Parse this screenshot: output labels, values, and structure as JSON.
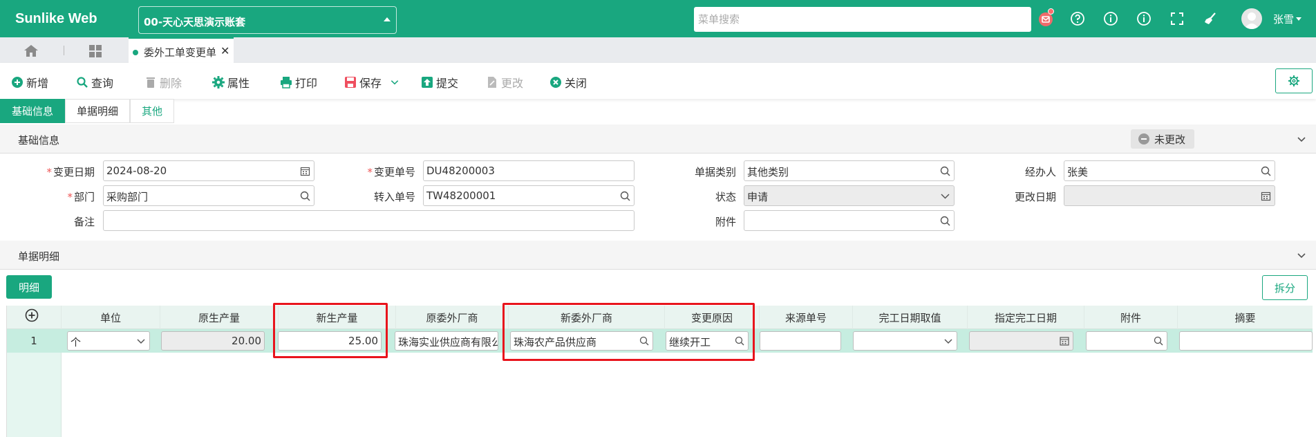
{
  "app": {
    "title": "Sunlike Web",
    "account": "00-天心天思演示账套"
  },
  "header": {
    "search_placeholder": "菜单搜索",
    "user": "张雪"
  },
  "tabs": {
    "document_tab": "委外工单变更单"
  },
  "toolbar": {
    "add": "新增",
    "query": "查询",
    "delete": "删除",
    "properties": "属性",
    "print": "打印",
    "save": "保存",
    "submit": "提交",
    "modify": "更改",
    "close": "关闭"
  },
  "section_tabs": [
    "基础信息",
    "单据明细",
    "其他"
  ],
  "basic_info": {
    "title": "基础信息",
    "status_chip": "未更改",
    "labels": {
      "change_date": "变更日期",
      "change_no": "变更单号",
      "doc_type": "单据类别",
      "handler": "经办人",
      "department": "部门",
      "transfer_no": "转入单号",
      "status": "状态",
      "modify_date": "更改日期",
      "remark": "备注",
      "attachment": "附件"
    },
    "values": {
      "change_date": "2024-08-20",
      "change_no": "DU48200003",
      "doc_type": "其他类别",
      "handler": "张美",
      "department": "采购部门",
      "transfer_no": "TW48200001",
      "status": "申请",
      "modify_date": "",
      "remark": "",
      "attachment": ""
    }
  },
  "details": {
    "title": "单据明细",
    "detail_button": "明细",
    "split_button": "拆分",
    "columns": [
      "单位",
      "原生产量",
      "新生产量",
      "原委外厂商",
      "新委外厂商",
      "变更原因",
      "来源单号",
      "完工日期取值",
      "指定完工日期",
      "附件",
      "摘要"
    ],
    "rows": [
      {
        "no": "1",
        "unit": "个",
        "orig_qty": "20.00",
        "new_qty": "25.00",
        "orig_vendor": "珠海实业供应商有限公",
        "new_vendor": "珠海农产品供应商",
        "reason": "继续开工",
        "source_no": "",
        "finish_value": "",
        "finish_date": "",
        "attachment": "",
        "summary": ""
      }
    ]
  },
  "colors": {
    "primary": "#19a77f",
    "highlight": "#e8141c"
  }
}
